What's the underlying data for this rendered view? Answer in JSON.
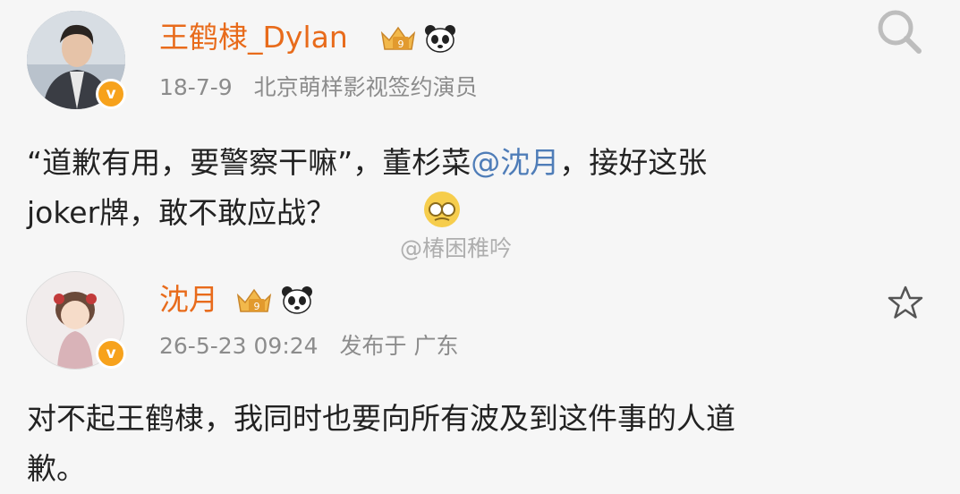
{
  "post1": {
    "author": "王鹤棣_Dylan",
    "date": "18-7-9",
    "source": "北京萌样影视签约演员",
    "text_line1_a": "“道歉有用，要警察干嘛”，董杉菜",
    "mention": "@沈月",
    "text_line1_b": "，接好这张",
    "text_line2": "joker牌，敢不敢应战？",
    "avatar_icon": "user-avatar-photo",
    "verified_badge": "v",
    "badge_icons": [
      "crown-badge-icon",
      "panda-icon"
    ],
    "emoji": "laughing-face-emoji"
  },
  "post2": {
    "author": "沈月",
    "date": "26-5-23 09:24",
    "location": "发布于 广东",
    "text_line1": "对不起王鹤棣，我同时也要向所有波及到这件事的人道",
    "text_line2": "歉。",
    "avatar_icon": "cartoon-avatar",
    "verified_badge": "v",
    "badge_icons": [
      "crown-badge-icon",
      "panda-icon"
    ]
  },
  "header": {
    "search_icon": "search-icon"
  },
  "actions": {
    "favorite_icon": "star-icon"
  },
  "watermark": "@椿困稚吟",
  "colors": {
    "name": "#e86b1b",
    "mention": "#4f7db8",
    "meta": "#8c8c8c",
    "verified": "#f7a21c"
  }
}
